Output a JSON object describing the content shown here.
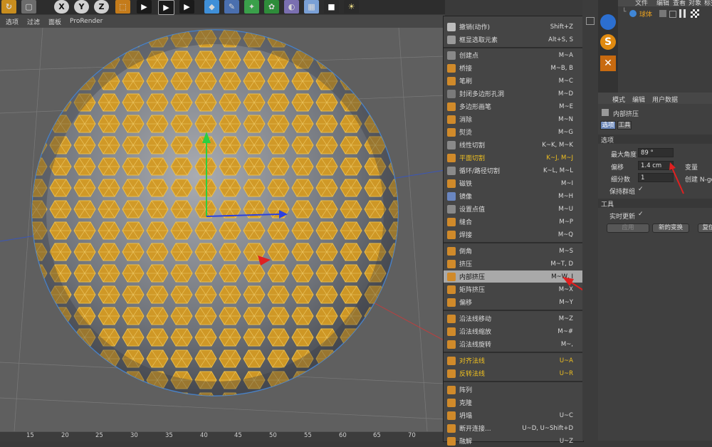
{
  "viewport_menu": [
    "选项",
    "过滤",
    "面板",
    "ProRender"
  ],
  "timeline_ticks": [
    "15",
    "20",
    "25",
    "30",
    "35",
    "40",
    "45",
    "50",
    "55",
    "60",
    "65",
    "70"
  ],
  "context_menu": {
    "items": [
      {
        "label": "撤销(动作)",
        "shortcut": "Shift+Z"
      },
      {
        "label": "框显选取元素",
        "shortcut": "Alt+S, S"
      },
      {
        "label": "创建点",
        "shortcut": "M~A"
      },
      {
        "label": "桥接",
        "shortcut": "M~B, B"
      },
      {
        "label": "笔刷",
        "shortcut": "M~C"
      },
      {
        "label": "封闭多边形孔洞",
        "shortcut": "M~D"
      },
      {
        "label": "多边形画笔",
        "shortcut": "M~E"
      },
      {
        "label": "消除",
        "shortcut": "M~N"
      },
      {
        "label": "熨烫",
        "shortcut": "M~G"
      },
      {
        "label": "线性切割",
        "shortcut": "K~K, M~K"
      },
      {
        "label": "平面切割",
        "shortcut": "K~J, M~J"
      },
      {
        "label": "循环/路径切割",
        "shortcut": "K~L, M~L"
      },
      {
        "label": "磁铁",
        "shortcut": "M~I"
      },
      {
        "label": "镜像",
        "shortcut": "M~H"
      },
      {
        "label": "设置点值",
        "shortcut": "M~U"
      },
      {
        "label": "缝合",
        "shortcut": "M~P"
      },
      {
        "label": "焊接",
        "shortcut": "M~Q"
      },
      {
        "label": "倒角",
        "shortcut": "M~S"
      },
      {
        "label": "挤压",
        "shortcut": "M~T, D"
      },
      {
        "label": "内部挤压",
        "shortcut": "M~W, I"
      },
      {
        "label": "矩阵挤压",
        "shortcut": "M~X"
      },
      {
        "label": "偏移",
        "shortcut": "M~Y"
      },
      {
        "label": "沿法线移动",
        "shortcut": "M~Z"
      },
      {
        "label": "沿法线缩放",
        "shortcut": "M~#"
      },
      {
        "label": "沿法线旋转",
        "shortcut": "M~,"
      },
      {
        "label": "对齐法线",
        "shortcut": "U~A"
      },
      {
        "label": "反转法线",
        "shortcut": "U~R"
      },
      {
        "label": "阵列",
        "shortcut": ""
      },
      {
        "label": "克隆",
        "shortcut": ""
      },
      {
        "label": "坍塌",
        "shortcut": "U~C"
      },
      {
        "label": "断开连接...",
        "shortcut": "U~D, U~Shift+D"
      },
      {
        "label": "融解",
        "shortcut": "U~Z"
      }
    ]
  },
  "object_manager": {
    "menu": [
      "文件",
      "编辑",
      "查看",
      "对象",
      "标签"
    ],
    "object_name": "球体"
  },
  "attributes": {
    "menu": [
      "模式",
      "编辑",
      "用户数据"
    ],
    "tool_title": "内部挤压",
    "tabs": [
      "选项",
      "工具"
    ],
    "section_options": "选项",
    "max_angle_label": "最大角度",
    "max_angle_value": "89 °",
    "offset_label": "偏移",
    "offset_value": "1.4 cm",
    "variation_label": "变量",
    "subdivision_label": "细分数",
    "subdivision_value": "1",
    "create_ngons_label": "创建 N-go",
    "preserve_groups_label": "保持群组",
    "section_tool": "工具",
    "realtime_update_label": "实时更新",
    "apply_button": "应用",
    "new_transform_button": "新的变换",
    "reset_button": "复位"
  },
  "colors": {
    "accent_orange": "#e89a1a",
    "highlight": "#a9a9a9",
    "yellow_text": "#f0c020",
    "arrow_red": "#e02020"
  }
}
